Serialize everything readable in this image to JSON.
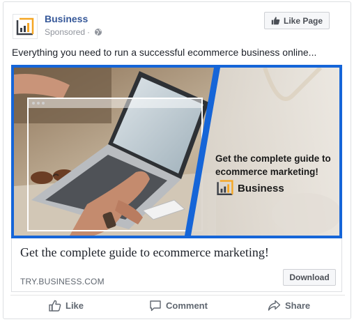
{
  "post": {
    "page_name": "Business",
    "sponsored_label": "Sponsored",
    "separator": "·",
    "like_page_label": "Like Page",
    "message": "Everything you need to run a successful ecommerce business online..."
  },
  "creative": {
    "overlay_headline": "Get the complete guide to ecommerce marketing!",
    "overlay_brand": "Business"
  },
  "link": {
    "title": "Get the complete guide to ecommerce marketing!",
    "domain": "TRY.BUSINESS.COM",
    "cta_label": "Download"
  },
  "actions": {
    "like": "Like",
    "comment": "Comment",
    "share": "Share"
  },
  "icons": {
    "logo": "bar-chart-logo-icon",
    "globe": "globe-icon",
    "thumb": "thumbs-up-icon",
    "comment": "comment-bubble-icon",
    "share": "share-arrow-icon"
  },
  "colors": {
    "brand_link": "#365899",
    "accent_border": "#1565d8",
    "logo_orange": "#f5a623",
    "logo_dark": "#3a3f47"
  }
}
